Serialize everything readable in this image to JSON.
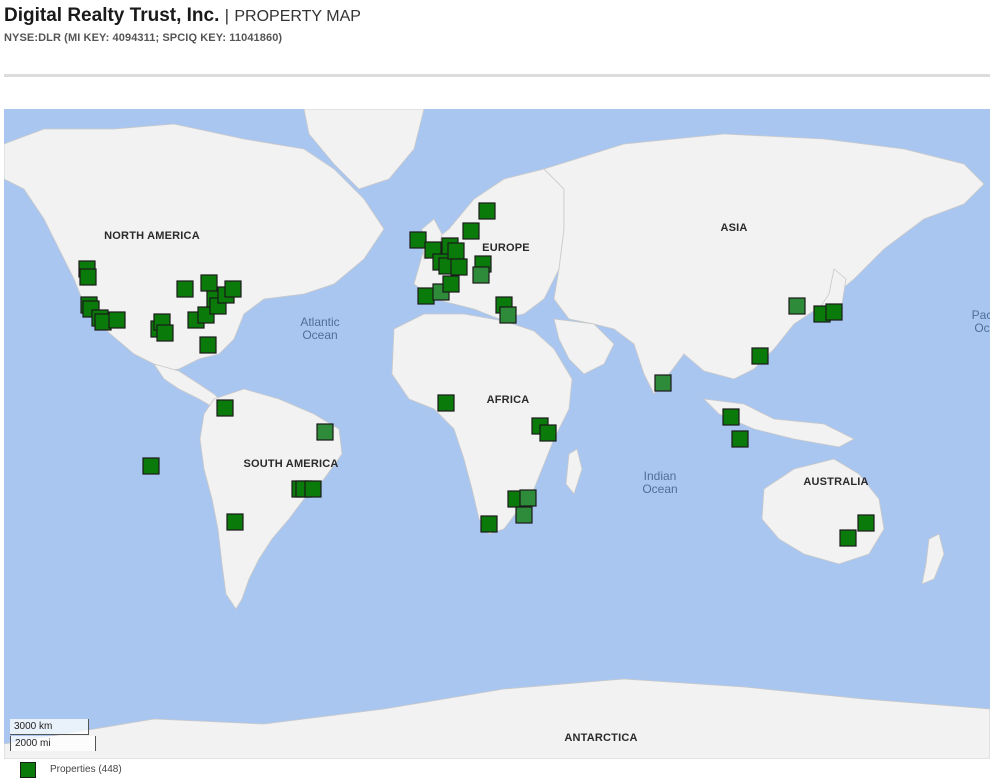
{
  "header": {
    "company": "Digital Realty Trust, Inc.",
    "separator": "|",
    "subtitle": "PROPERTY MAP",
    "keys": "NYSE:DLR (MI KEY: 4094311; SPCIQ KEY: 11041860)"
  },
  "map": {
    "continents": [
      {
        "name": "NORTH AMERICA"
      },
      {
        "name": "SOUTH AMERICA"
      },
      {
        "name": "EUROPE"
      },
      {
        "name": "AFRICA"
      },
      {
        "name": "ASIA"
      },
      {
        "name": "AUSTRALIA"
      },
      {
        "name": "ANTARCTICA"
      }
    ],
    "oceans": [
      {
        "line1": "Atlantic",
        "line2": "Ocean"
      },
      {
        "line1": "Indian",
        "line2": "Ocean"
      },
      {
        "line1": "Pac",
        "line2": "Oc"
      }
    ],
    "scale": {
      "km": "3000 km",
      "mi": "2000 mi"
    },
    "colors": {
      "ocean": "#a9c6f0",
      "land": "#f2f2f2",
      "marker": "#0a7a0a",
      "marker_light": "#2e8b3a"
    }
  },
  "legend": {
    "label": "Properties (448)"
  }
}
